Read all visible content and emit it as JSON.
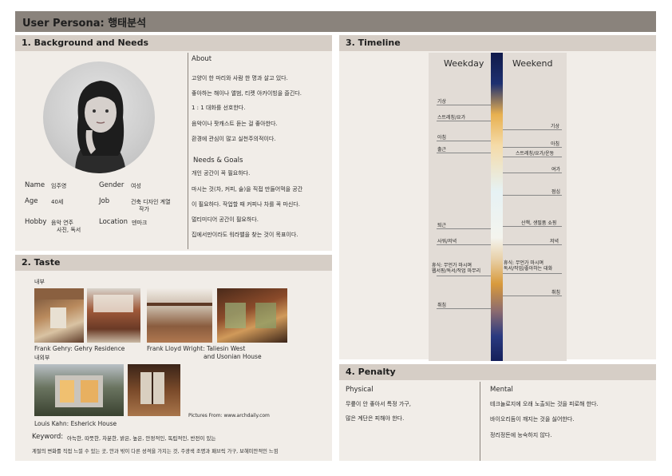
{
  "title": "User Persona: 행태분석",
  "background": {
    "heading": "1. Background and Needs",
    "about_heading": "About",
    "about_lines": [
      "고양이 한 마리와 사람 한 명과 살고 있다.",
      "좋아하는 해이나 앨범, 티켓 아카이빙을 즐긴다.",
      "1 : 1 대화를 선호한다.",
      "음악이나 팟캐스트 듣는 걸 좋아한다.",
      "환경에 관심이 많고 실천주의적이다."
    ],
    "needs_heading": "Needs &  Goals",
    "needs_lines": [
      "개인 공간이 꼭 필요하다.",
      "마시는 것(차, 커피, 술)을 직접 만들어먹을 공간",
      "이 필요하다. 작업할 때 커피나 차를 꼭 마신다.",
      "멀티미디어 공간이 필요하다.",
      "집에서만이라도 워라밸을 찾는 것이 목표이다."
    ],
    "fields": {
      "name_label": "Name",
      "name_value": "임주영",
      "gender_label": "Gender",
      "gender_value": "여성",
      "age_label": "Age",
      "age_value": "40세",
      "job_label": "Job",
      "job_value_1": "건축 디자인 계열",
      "job_value_2": "작가",
      "hobby_label": "Hobby",
      "hobby_value_1": "음악 연주",
      "hobby_value_2": "사진, 독서",
      "location_label": "Location",
      "location_value": "덴마크"
    }
  },
  "taste": {
    "heading": "2. Taste",
    "interior_label": "내부",
    "caption_gehry": "Frank Gehry: Gehry Residence",
    "caption_wright_1": "Frank Lloyd Wright: Taliesin West",
    "caption_wright_2": "and Usonian House",
    "exterior_label": "내외부",
    "caption_kahn": "Louis Kahn: Esherick House",
    "credit": "Pictures From: www.archdaily.com",
    "keyword_label": "Keyword:",
    "keyword_text": "아늑한, 따뜻한, 차분한, 밝은, 높은, 안정적인, 독립적인, 반전이 있는",
    "summary": "계절의 변화를 직접 느낄 수 있는 곳, 안과 밖이 다른 성격을 가지는 것, 주광색 조명과 패브릭 가구, 보헤미안적인 느낌"
  },
  "timeline": {
    "heading": "3. Timeline",
    "weekday_label": "Weekday",
    "weekend_label": "Weekend",
    "weekday_events": [
      "기상",
      "스트레칭/요가",
      "아침",
      "출근",
      "퇴근",
      "사워/저녁",
      "휴식: 무언가 마시며",
      "웹서핑/독서/작업 마무리",
      "취침"
    ],
    "weekend_events": [
      "기상",
      "아침",
      "스트레칭/요가/운동",
      "여가",
      "점심",
      "산책, 생필품 쇼핑",
      "저녁",
      "휴식: 무언가 마시며",
      "독서/작업/좋아하는 대화",
      "취침"
    ]
  },
  "penalty": {
    "heading": "4. Penalty",
    "physical_heading": "Physical",
    "physical_lines": [
      "무릎이 안 좋아서 특정 가구,",
      "많은 계단은 피해야 한다."
    ],
    "mental_heading": "Mental",
    "mental_lines": [
      "테크놀로지에 오래 노출되는 것을 피로해 한다.",
      "바이오리듬이 깨지는 것을 싫어한다.",
      "정리정돈에 능숙하지 않다."
    ]
  },
  "colors": {
    "title_bar": "#8a837c",
    "section_header": "#d6cec6",
    "panel_bg": "#f1ede8",
    "timeline_bg": "#e2dcd6"
  }
}
